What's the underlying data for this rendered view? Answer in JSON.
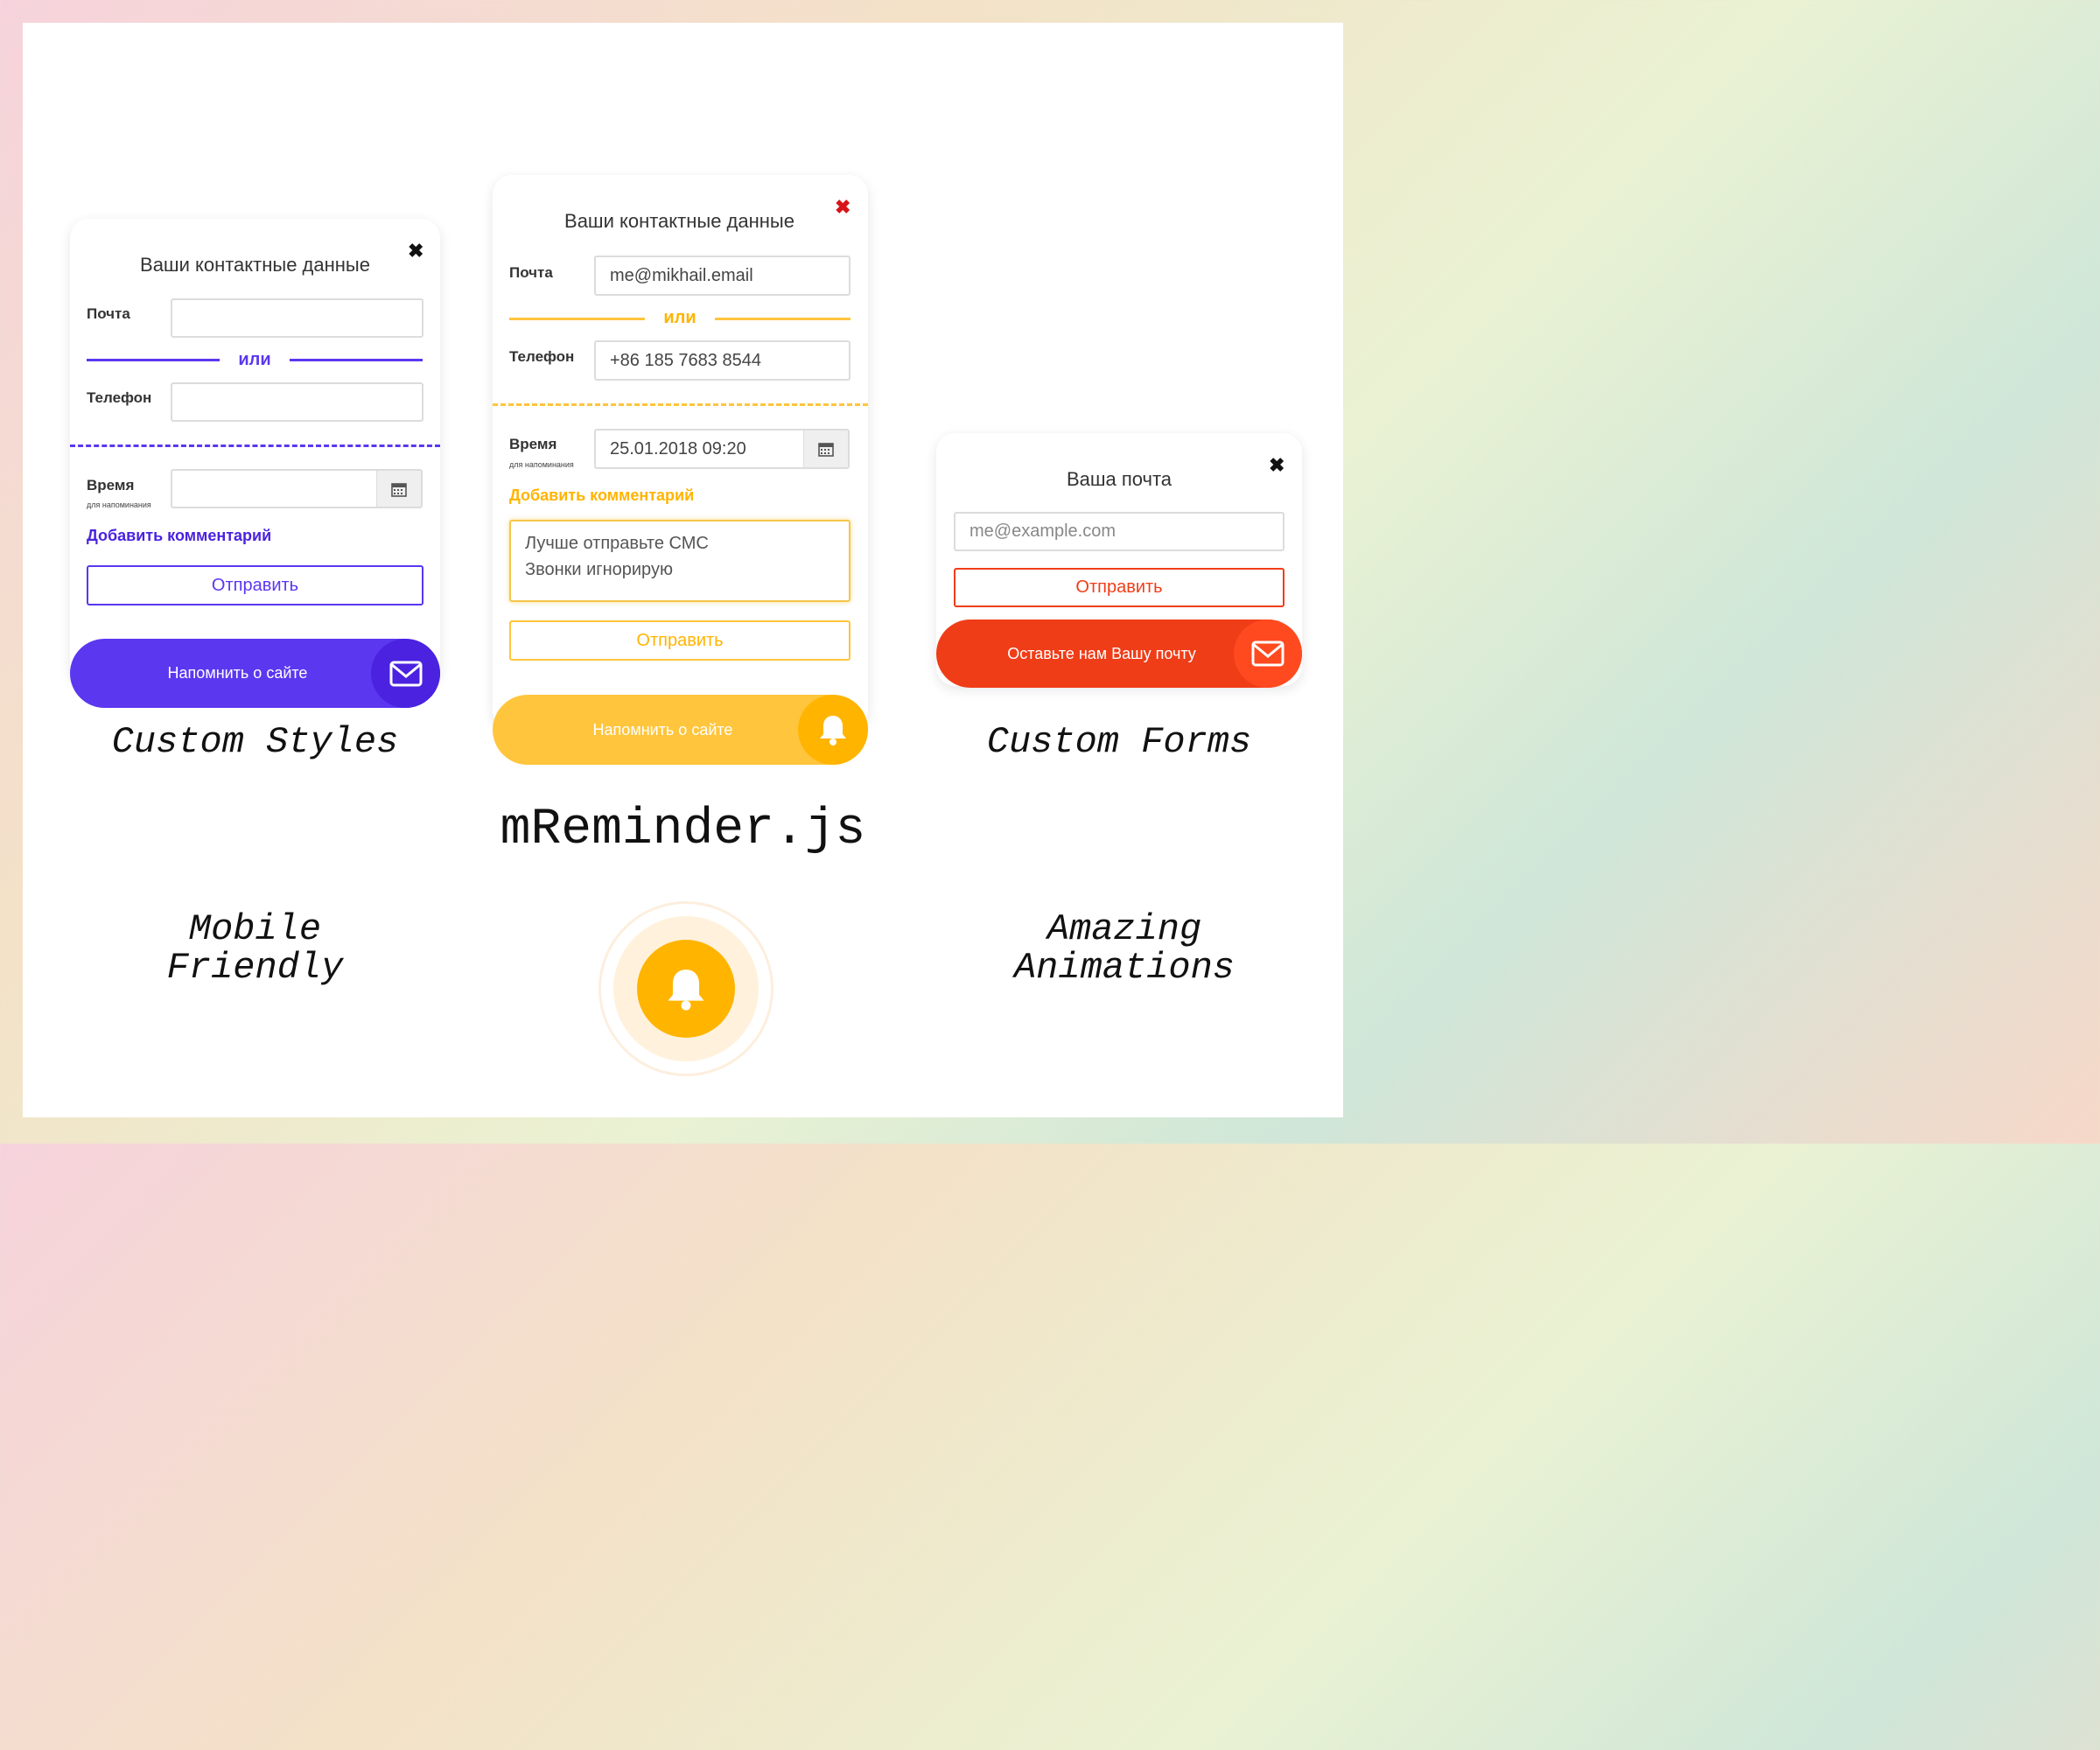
{
  "colors": {
    "purple": "#5b37f0",
    "purple_dark": "#4a22e0",
    "yellow": "#ffc53d",
    "yellow_dark": "#ffb400",
    "orange_red": "#ef3d18",
    "red_close": "#d8141a"
  },
  "card_purple": {
    "title": "Ваши контактные данные",
    "close_icon": "close-icon",
    "email_label": "Почта",
    "email_value": "",
    "or_text": "или",
    "phone_label": "Телефон",
    "phone_value": "",
    "time_label": "Время",
    "time_sublabel": "для напоминания",
    "time_value": "",
    "comment_link": "Добавить комментарий",
    "submit": "Отправить",
    "remind": "Напомнить о сайте",
    "remind_icon": "envelope-icon"
  },
  "card_yellow": {
    "title": "Ваши контактные данные",
    "close_icon": "close-icon",
    "email_label": "Почта",
    "email_value": "me@mikhail.email",
    "or_text": "или",
    "phone_label": "Телефон",
    "phone_value": "+86 185 7683 8544",
    "time_label": "Время",
    "time_sublabel": "для напоминания",
    "time_value": "25.01.2018 09:20",
    "comment_link": "Добавить комментарий",
    "comment_line1": "Лучше отправьте СМС",
    "comment_line2": "Звонки игнорирую",
    "submit": "Отправить",
    "remind": "Напомнить о сайте",
    "remind_icon": "bell-icon"
  },
  "card_red": {
    "title": "Ваша почта",
    "close_icon": "close-icon",
    "email_placeholder": "me@example.com",
    "submit": "Отправить",
    "remind": "Оставьте нам Вашу почту",
    "remind_icon": "envelope-icon"
  },
  "captions": {
    "custom_styles": "Custom Styles",
    "custom_forms": "Custom Forms",
    "brand": "mReminder.js",
    "mobile_1": "Mobile",
    "mobile_2": "Friendly",
    "amazing_1": "Amazing",
    "amazing_2": "Animations"
  }
}
